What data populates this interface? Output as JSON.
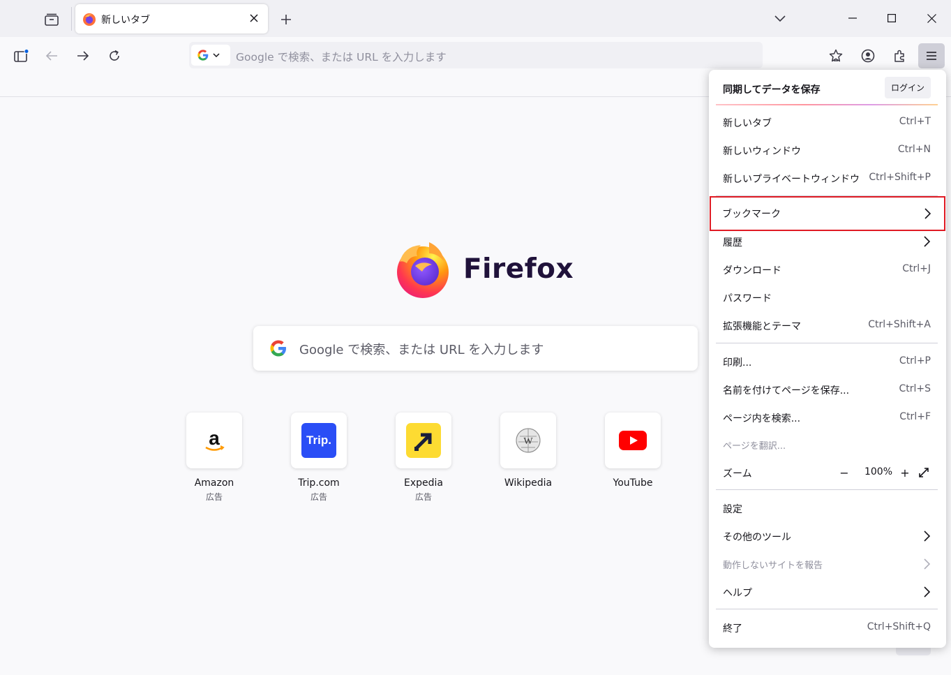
{
  "tab": {
    "title": "新しいタブ"
  },
  "urlbar": {
    "placeholder": "Google で検索、または URL を入力します"
  },
  "content": {
    "wordmark": "Firefox",
    "search_placeholder": "Google で検索、または URL を入力します",
    "shortcuts": [
      {
        "name": "Amazon",
        "sponsor": "広告"
      },
      {
        "name": "Trip.com",
        "sponsor": "広告"
      },
      {
        "name": "Expedia",
        "sponsor": "広告"
      },
      {
        "name": "Wikipedia",
        "sponsor": ""
      },
      {
        "name": "YouTube",
        "sponsor": ""
      }
    ],
    "trip_logo_text": "Trip."
  },
  "menu": {
    "sync_label": "同期してデータを保存",
    "login_label": "ログイン",
    "items": [
      {
        "label": "新しいタブ",
        "shortcut": "Ctrl+T"
      },
      {
        "label": "新しいウィンドウ",
        "shortcut": "Ctrl+N"
      },
      {
        "label": "新しいプライベートウィンドウ",
        "shortcut": "Ctrl+Shift+P"
      },
      {
        "label": "ブックマーク",
        "shortcut": ""
      },
      {
        "label": "履歴",
        "shortcut": ""
      },
      {
        "label": "ダウンロード",
        "shortcut": "Ctrl+J"
      },
      {
        "label": "パスワード",
        "shortcut": ""
      },
      {
        "label": "拡張機能とテーマ",
        "shortcut": "Ctrl+Shift+A"
      },
      {
        "label": "印刷...",
        "shortcut": "Ctrl+P"
      },
      {
        "label": "名前を付けてページを保存...",
        "shortcut": "Ctrl+S"
      },
      {
        "label": "ページ内を検索...",
        "shortcut": "Ctrl+F"
      },
      {
        "label": "ページを翻訳...",
        "shortcut": ""
      },
      {
        "label": "ズーム",
        "shortcut": ""
      },
      {
        "label": "設定",
        "shortcut": ""
      },
      {
        "label": "その他のツール",
        "shortcut": ""
      },
      {
        "label": "動作しないサイトを報告",
        "shortcut": ""
      },
      {
        "label": "ヘルプ",
        "shortcut": ""
      },
      {
        "label": "終了",
        "shortcut": "Ctrl+Shift+Q"
      }
    ],
    "zoom": {
      "minus": "−",
      "value": "100%",
      "plus": "+"
    }
  },
  "colors": {
    "highlight": "#e01b24",
    "accent": "#0060df"
  },
  "icons": [
    "tab-overview-icon",
    "firefox-icon",
    "close-icon",
    "plus-icon",
    "chevron-down-icon",
    "minimize-icon",
    "maximize-icon",
    "window-close-icon",
    "sidebar-icon",
    "back-icon",
    "forward-icon",
    "reload-icon",
    "google-icon",
    "bookmark-star-icon",
    "account-icon",
    "extensions-icon",
    "hamburger-menu-icon",
    "chevron-right-icon",
    "fullscreen-icon"
  ]
}
